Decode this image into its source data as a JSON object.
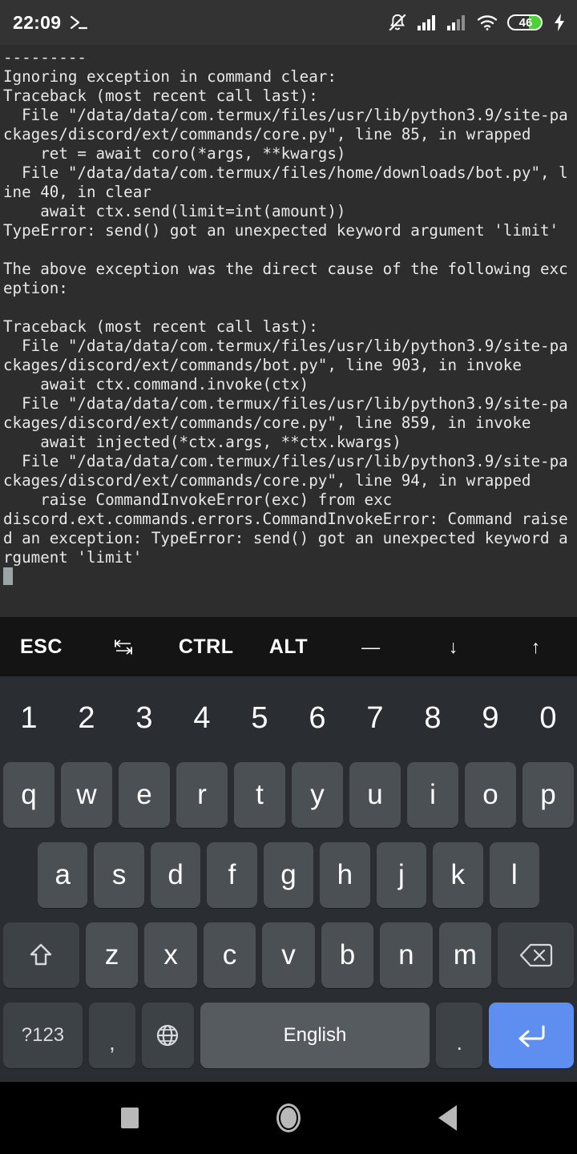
{
  "statusbar": {
    "time": "22:09",
    "terminal_icon": "terminal-prompt-icon",
    "icons": [
      "notifications-muted-icon",
      "signal-sim1-icon",
      "signal-sim2-icon",
      "wifi-icon",
      "battery-icon",
      "charging-bolt-icon"
    ],
    "battery_level": "46",
    "battery_color": "#4CD137"
  },
  "terminal": {
    "output": "---------\nIgnoring exception in command clear:\nTraceback (most recent call last):\n  File \"/data/data/com.termux/files/usr/lib/python3.9/site-packages/discord/ext/commands/core.py\", line 85, in wrapped\n    ret = await coro(*args, **kwargs)\n  File \"/data/data/com.termux/files/home/downloads/bot.py\", line 40, in clear\n    await ctx.send(limit=int(amount))\nTypeError: send() got an unexpected keyword argument 'limit'\n\nThe above exception was the direct cause of the following exception:\n\nTraceback (most recent call last):\n  File \"/data/data/com.termux/files/usr/lib/python3.9/site-packages/discord/ext/commands/bot.py\", line 903, in invoke\n    await ctx.command.invoke(ctx)\n  File \"/data/data/com.termux/files/usr/lib/python3.9/site-packages/discord/ext/commands/core.py\", line 859, in invoke\n    await injected(*ctx.args, **ctx.kwargs)\n  File \"/data/data/com.termux/files/usr/lib/python3.9/site-packages/discord/ext/commands/core.py\", line 94, in wrapped\n    raise CommandInvokeError(exc) from exc\ndiscord.ext.commands.errors.CommandInvokeError: Command raised an exception: TypeError: send() got an unexpected keyword argument 'limit'\n",
    "text_color": "#e8e8e8",
    "background": "#2d2d2d"
  },
  "extra_keys": [
    {
      "label": "ESC",
      "name": "esc"
    },
    {
      "label": "⇤⇥",
      "name": "tab"
    },
    {
      "label": "CTRL",
      "name": "ctrl"
    },
    {
      "label": "ALT",
      "name": "alt"
    },
    {
      "label": "—",
      "name": "dash"
    },
    {
      "label": "↓",
      "name": "down-arrow"
    },
    {
      "label": "↑",
      "name": "up-arrow"
    }
  ],
  "keyboard": {
    "row_numbers": [
      "1",
      "2",
      "3",
      "4",
      "5",
      "6",
      "7",
      "8",
      "9",
      "0"
    ],
    "row_top": [
      "q",
      "w",
      "e",
      "r",
      "t",
      "y",
      "u",
      "i",
      "o",
      "p"
    ],
    "row_home": [
      "a",
      "s",
      "d",
      "f",
      "g",
      "h",
      "j",
      "k",
      "l"
    ],
    "row_bottom_letters": [
      "z",
      "x",
      "c",
      "v",
      "b",
      "n",
      "m"
    ],
    "shift_label": "⇧",
    "backspace_label": "⌫",
    "symbols_label": "?123",
    "comma_label": ",",
    "globe_label": "globe",
    "space_label": "English",
    "period_label": ".",
    "enter_label": "⏎",
    "enter_color": "#5d8ef0",
    "key_color": "#4b5055",
    "keyboard_background": "#2a2e33"
  },
  "navbar": {
    "recents_label": "recents",
    "home_label": "home",
    "back_label": "back"
  }
}
